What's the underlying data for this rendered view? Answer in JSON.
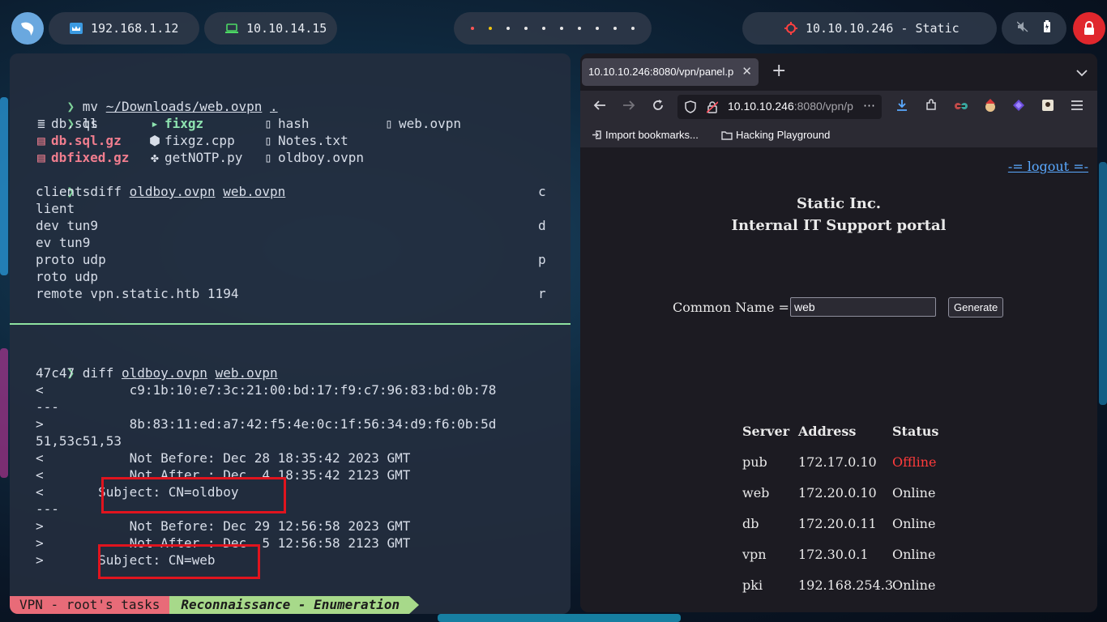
{
  "topbar": {
    "ip_local": "192.168.1.12",
    "ip_vpn": "10.10.14.15",
    "target": "10.10.10.246 - Static",
    "workspace_dots": 10,
    "colors": {
      "dot_active_red": "#ff5555",
      "dot_active_yellow": "#f1c40f",
      "lock_bg": "#e0272d",
      "target_icon": "#ff4040"
    }
  },
  "terminal": {
    "pane1": [
      {
        "type": "prompt",
        "cmd": "mv",
        "args": [
          "~/Downloads/web.ovpn",
          "."
        ]
      },
      {
        "type": "prompt",
        "cmd": "ls",
        "args": []
      },
      {
        "type": "ls",
        "items": [
          {
            "icon": "db",
            "name": "db.sql",
            "style": "normal"
          },
          {
            "icon": "term",
            "name": "fixgz",
            "style": "green"
          },
          {
            "icon": "file",
            "name": "hash",
            "style": "normal"
          },
          {
            "icon": "file",
            "name": "web.ovpn",
            "style": "normal"
          }
        ]
      },
      {
        "type": "ls",
        "items": [
          {
            "icon": "zip",
            "name": "db.sql.gz",
            "style": "red"
          },
          {
            "icon": "cpp",
            "name": "fixgz.cpp",
            "style": "normal"
          },
          {
            "icon": "file",
            "name": "Notes.txt",
            "style": "normal"
          }
        ]
      },
      {
        "type": "ls",
        "items": [
          {
            "icon": "zip",
            "name": "dbfixed.gz",
            "style": "red"
          },
          {
            "icon": "py",
            "name": "getNOTP.py",
            "style": "normal"
          },
          {
            "icon": "file",
            "name": "oldboy.ovpn",
            "style": "normal"
          }
        ]
      },
      {
        "type": "prompt",
        "cmd": "sdiff",
        "args": [
          "oldboy.ovpn",
          "web.ovpn"
        ]
      }
    ],
    "sdiff_rows": [
      {
        "left": "client",
        "right": "c"
      },
      {
        "left": "lient",
        "right": ""
      },
      {
        "left": "dev tun9",
        "right": "d"
      },
      {
        "left": "ev tun9",
        "right": ""
      },
      {
        "left": "proto udp",
        "right": "p"
      },
      {
        "left": "roto udp",
        "right": ""
      },
      {
        "left": "remote vpn.static.htb 1194",
        "right": "r"
      }
    ],
    "pane2_prompt": {
      "cmd": "diff",
      "args": [
        "oldboy.ovpn",
        "web.ovpn"
      ]
    },
    "diff_lines": [
      "47c47",
      "<           c9:1b:10:e7:3c:21:00:bd:17:f9:c7:96:83:bd:0b:78",
      "---",
      ">           8b:83:11:ed:a7:42:f5:4e:0c:1f:56:34:d9:f6:0b:5d",
      "51,53c51,53",
      "<           Not Before: Dec 28 18:35:42 2023 GMT",
      "<           Not After : Dec  4 18:35:42 2123 GMT",
      "<       Subject: CN=oldboy",
      "---",
      ">           Not Before: Dec 29 12:56:58 2023 GMT",
      ">           Not After : Dec  5 12:56:58 2123 GMT",
      ">       Subject: CN=web"
    ],
    "status_left": "VPN - root's tasks",
    "status_right": "Reconnaissance - Enumeration"
  },
  "browser": {
    "tab_title": "10.10.10.246:8080/vpn/panel.p",
    "url_host": "10.10.10.246",
    "url_rest": ":8080/vpn/p",
    "bookmarks": [
      "Import bookmarks...",
      "Hacking Playground"
    ],
    "page": {
      "logout": "-= logout =-",
      "title1": "Static Inc.",
      "title2": "Internal IT Support portal",
      "cn_label": "Common Name =",
      "cn_value": "web",
      "generate_label": "Generate",
      "table_headers": [
        "Server",
        "Address",
        "Status"
      ],
      "servers": [
        {
          "name": "pub",
          "address": "172.17.0.10",
          "status": "Offline"
        },
        {
          "name": "web",
          "address": "172.20.0.10",
          "status": "Online"
        },
        {
          "name": "db",
          "address": "172.20.0.11",
          "status": "Online"
        },
        {
          "name": "vpn",
          "address": "172.30.0.1",
          "status": "Online"
        },
        {
          "name": "pki",
          "address": "192.168.254.3",
          "status": "Online"
        }
      ],
      "colors": {
        "offline": "#ff3b3b",
        "link": "#5aa9ff"
      }
    }
  }
}
